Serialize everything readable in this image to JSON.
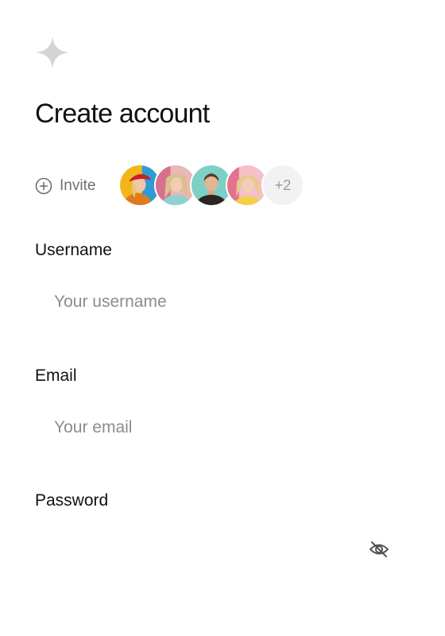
{
  "brand": {
    "logo_icon": "sparkle-icon",
    "logo_color": "#d4d4d4"
  },
  "page": {
    "title": "Create account"
  },
  "invite": {
    "label": "Invite",
    "icon": "plus-circle-icon",
    "avatars": [
      {
        "name": "avatar-1"
      },
      {
        "name": "avatar-2"
      },
      {
        "name": "avatar-3"
      },
      {
        "name": "avatar-4"
      }
    ],
    "more_count": "+2"
  },
  "form": {
    "username": {
      "label": "Username",
      "placeholder": "Your username",
      "value": ""
    },
    "email": {
      "label": "Email",
      "placeholder": "Your email",
      "value": ""
    },
    "password": {
      "label": "Password",
      "placeholder": "",
      "value": "",
      "toggle_icon": "eye-off-icon"
    }
  }
}
